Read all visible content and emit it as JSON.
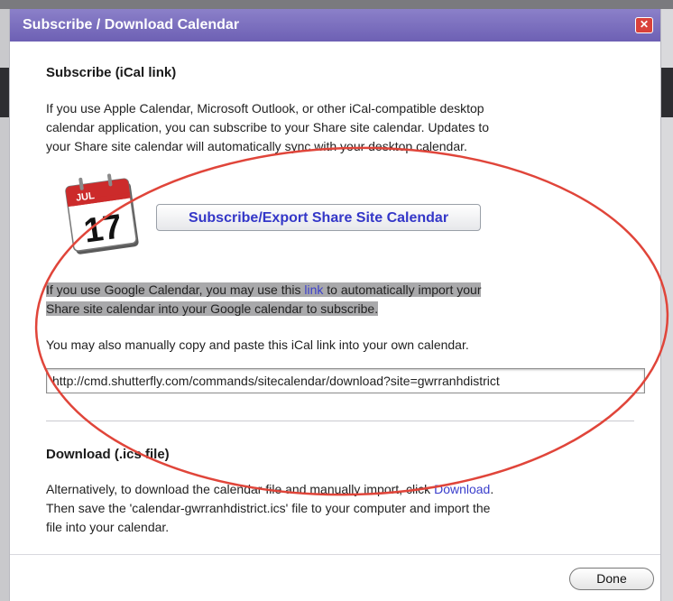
{
  "dialog": {
    "title": "Subscribe / Download Calendar",
    "close_glyph": "✕"
  },
  "subscribe_section": {
    "heading": "Subscribe (iCal link)",
    "intro_line1": "If you use Apple Calendar, Microsoft Outlook, or other iCal-compatible desktop",
    "intro_line2": "calendar application, you can subscribe to your Share site calendar. Updates to",
    "intro_line3": "your Share site calendar will automatically sync with your desktop calendar.",
    "calendar_icon_month": "JUL",
    "calendar_icon_day": "17",
    "subscribe_button_label": "Subscribe/Export Share Site Calendar",
    "google_before_link": "If you use Google Calendar, you may use this ",
    "google_link": "link",
    "google_after_link": " to automatically import your",
    "google_line2": "Share site calendar into your Google calendar to subscribe.",
    "manual_copy_text": "You may also manually copy and paste this iCal link into your own calendar.",
    "ical_url": "http://cmd.shutterfly.com/commands/sitecalendar/download?site=gwrranhdistrict"
  },
  "download_section": {
    "heading": "Download (.ics file)",
    "line1_before_link": "Alternatively, to download the calendar file and manually import, click ",
    "line1_link": "Download",
    "line1_after_link": ".",
    "line2": "Then save the 'calendar-gwrranhdistrict.ics' file to your computer and import the",
    "line3": "file into your calendar."
  },
  "footer": {
    "done_label": "Done"
  },
  "colors": {
    "titlebar": "#7367bb",
    "link": "#3b3fcc",
    "annotation_ellipse": "#e0453a",
    "highlight": "#a9a9ab"
  }
}
